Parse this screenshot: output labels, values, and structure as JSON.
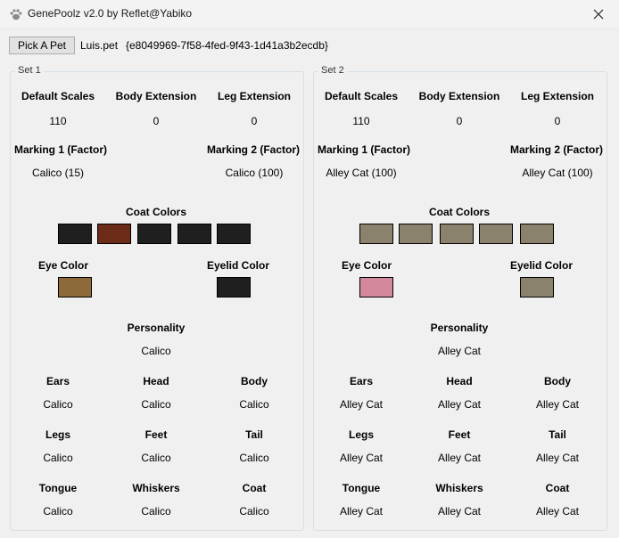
{
  "window": {
    "title": "GenePoolz v2.0 by Reflet@Yabiko"
  },
  "toolbar": {
    "pick_label": "Pick A Pet",
    "filename": "Luis.pet",
    "guid": "{e8049969-7f58-4fed-9f43-1d41a3b2ecdb}"
  },
  "sets": [
    {
      "title": "Set 1",
      "default_scales_label": "Default Scales",
      "default_scales": "110",
      "body_ext_label": "Body Extension",
      "body_ext": "0",
      "leg_ext_label": "Leg Extension",
      "leg_ext": "0",
      "marking1_label": "Marking 1 (Factor)",
      "marking1": "Calico (15)",
      "marking2_label": "Marking 2 (Factor)",
      "marking2": "Calico (100)",
      "coat_colors_label": "Coat Colors",
      "coat_colors": [
        "#1f1f1f",
        "#6b2b17",
        "#1f1f1f",
        "#1f1f1f",
        "#1f1f1f"
      ],
      "eye_color_label": "Eye Color",
      "eye_color": "#8c6a3a",
      "eyelid_color_label": "Eyelid Color",
      "eyelid_color": "#1f1f1f",
      "personality_label": "Personality",
      "personality": "Calico",
      "ears_label": "Ears",
      "ears": "Calico",
      "head_label": "Head",
      "head": "Calico",
      "body_label": "Body",
      "body": "Calico",
      "legs_label": "Legs",
      "legs": "Calico",
      "feet_label": "Feet",
      "feet": "Calico",
      "tail_label": "Tail",
      "tail": "Calico",
      "tongue_label": "Tongue",
      "tongue": "Calico",
      "whiskers_label": "Whiskers",
      "whiskers": "Calico",
      "coat_label": "Coat",
      "coat": "Calico"
    },
    {
      "title": "Set 2",
      "default_scales_label": "Default Scales",
      "default_scales": "110",
      "body_ext_label": "Body Extension",
      "body_ext": "0",
      "leg_ext_label": "Leg Extension",
      "leg_ext": "0",
      "marking1_label": "Marking 1 (Factor)",
      "marking1": "Alley Cat (100)",
      "marking2_label": "Marking 2 (Factor)",
      "marking2": "Alley Cat (100)",
      "coat_colors_label": "Coat Colors",
      "coat_colors": [
        "#8a826c",
        "#8a826c",
        "#8a826c",
        "#8a826c",
        "#8a826c"
      ],
      "eye_color_label": "Eye Color",
      "eye_color": "#d4889c",
      "eyelid_color_label": "Eyelid Color",
      "eyelid_color": "#8a826c",
      "personality_label": "Personality",
      "personality": "Alley Cat",
      "ears_label": "Ears",
      "ears": "Alley Cat",
      "head_label": "Head",
      "head": "Alley Cat",
      "body_label": "Body",
      "body": "Alley Cat",
      "legs_label": "Legs",
      "legs": "Alley Cat",
      "feet_label": "Feet",
      "feet": "Alley Cat",
      "tail_label": "Tail",
      "tail": "Alley Cat",
      "tongue_label": "Tongue",
      "tongue": "Alley Cat",
      "whiskers_label": "Whiskers",
      "whiskers": "Alley Cat",
      "coat_label": "Coat",
      "coat": "Alley Cat"
    }
  ]
}
